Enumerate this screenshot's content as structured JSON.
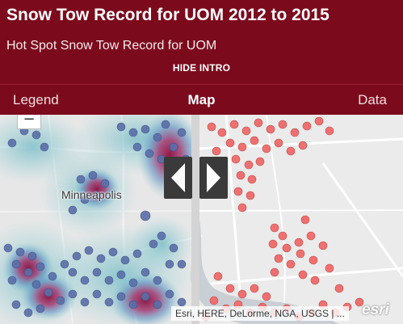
{
  "header": {
    "title": "Snow Tow Record for UOM 2012 to 2015",
    "subtitle": "Hot Spot Snow Tow Record for UOM",
    "hide_intro": "HIDE INTRO"
  },
  "tabs": {
    "legend": "Legend",
    "map": "Map",
    "data": "Data"
  },
  "map": {
    "zoom_out_label": "−",
    "city_label": "Minneapolis",
    "attribution": "Esri, HERE, DeLorme, NGA, USGS | ...",
    "logo": "esri"
  },
  "colors": {
    "brand": "#7c0a1d",
    "hotspot_point": "#5a6ea8",
    "tow_point": "#f07070"
  }
}
